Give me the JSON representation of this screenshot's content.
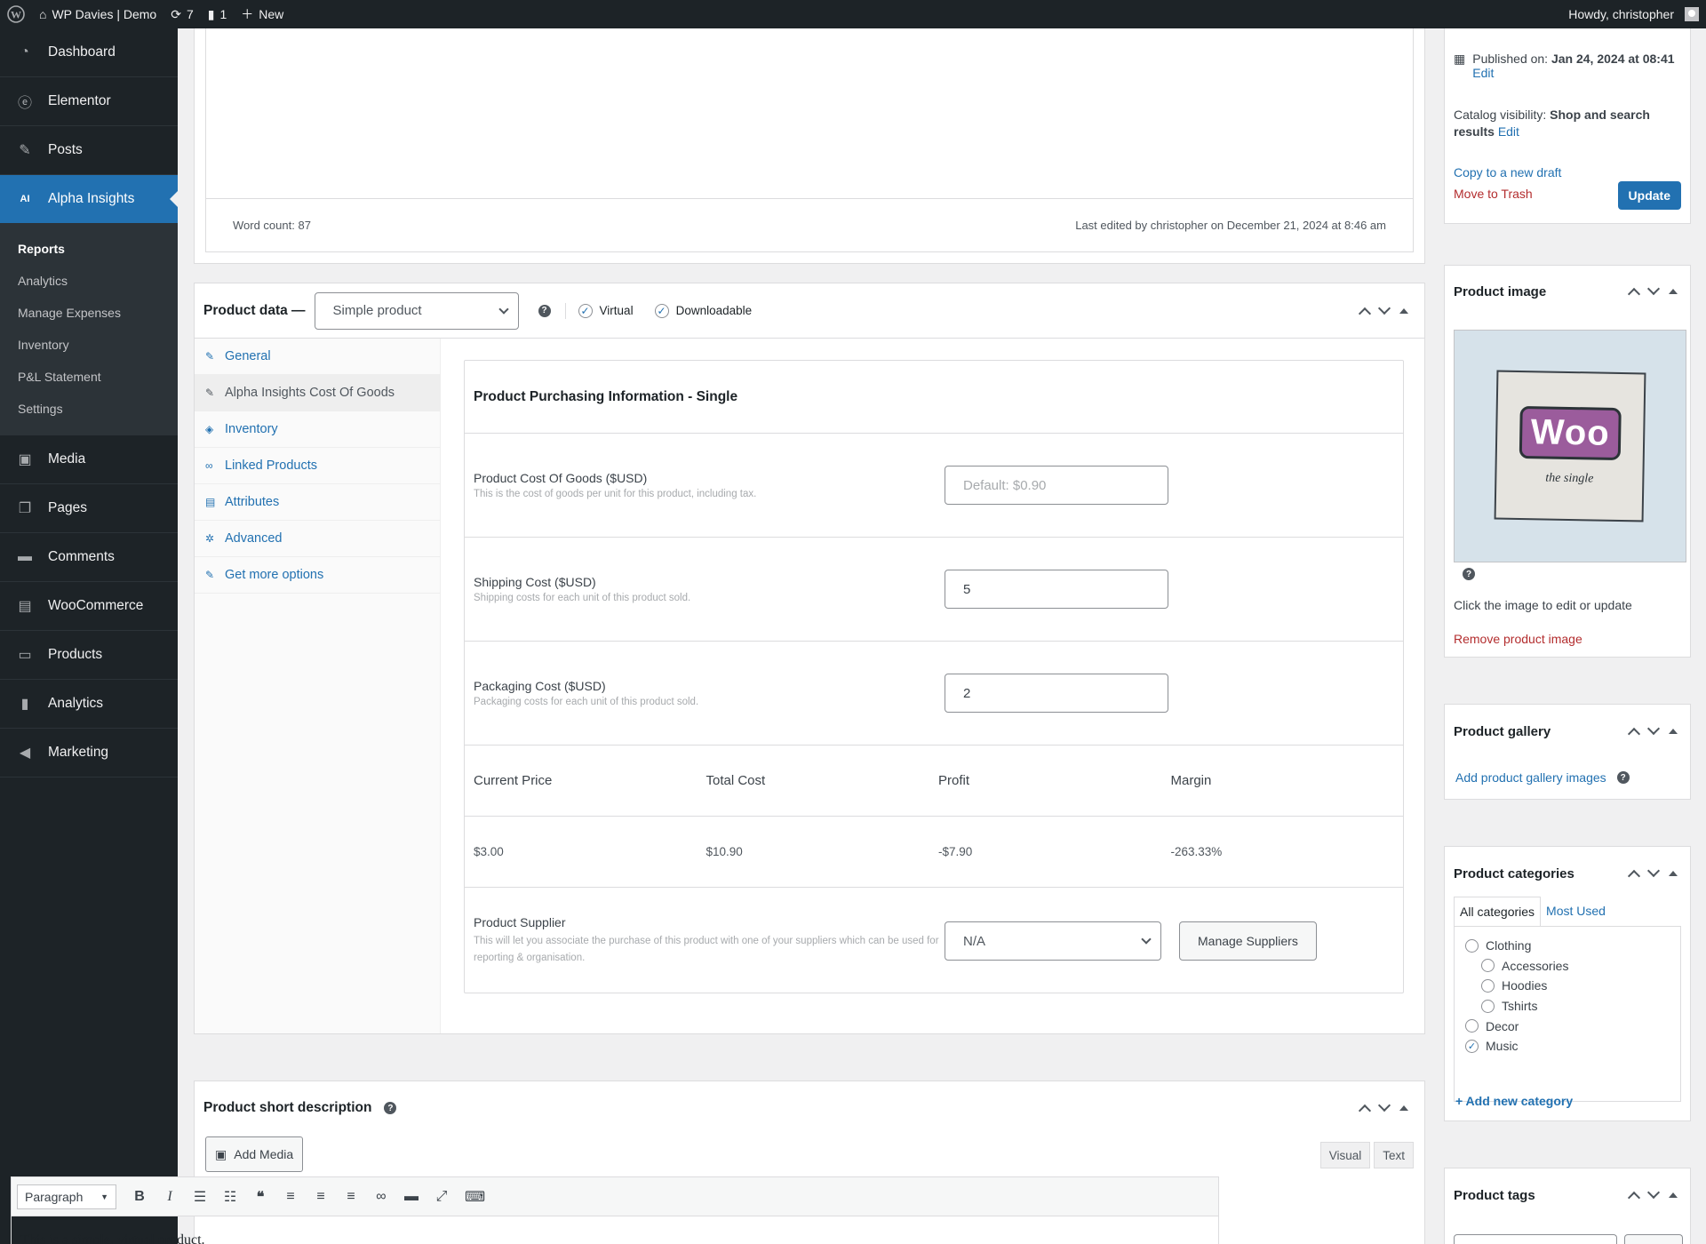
{
  "adminbar": {
    "site_name": "WP Davies | Demo",
    "updates_count": "7",
    "comments_count": "1",
    "new_label": "New",
    "howdy": "Howdy, christopher"
  },
  "sidebar": {
    "items": [
      {
        "label": "Dashboard",
        "icon": "dashboard-icon"
      },
      {
        "label": "Elementor",
        "icon": "elementor-icon"
      },
      {
        "label": "Posts",
        "icon": "pin-icon"
      },
      {
        "label": "Alpha Insights",
        "icon": "ai-icon"
      },
      {
        "label": "Media",
        "icon": "media-icon"
      },
      {
        "label": "Pages",
        "icon": "pages-icon"
      },
      {
        "label": "Comments",
        "icon": "comment-icon"
      },
      {
        "label": "WooCommerce",
        "icon": "woo-icon"
      },
      {
        "label": "Products",
        "icon": "archive-icon"
      },
      {
        "label": "Analytics",
        "icon": "chart-icon"
      },
      {
        "label": "Marketing",
        "icon": "megaphone-icon"
      }
    ],
    "ai_badge": "AI",
    "submenu": [
      "Reports",
      "Analytics",
      "Manage Expenses",
      "Inventory",
      "P&L Statement",
      "Settings"
    ]
  },
  "editor": {
    "word_count": "Word count: 87",
    "last_edited": "Last edited by christopher on December 21, 2024 at 8:46 am"
  },
  "product_data": {
    "title": "Product data —",
    "type_value": "Simple product",
    "virtual_label": "Virtual",
    "downloadable_label": "Downloadable",
    "tabs": [
      "General",
      "Alpha Insights Cost Of Goods",
      "Inventory",
      "Linked Products",
      "Attributes",
      "Advanced",
      "Get more options"
    ],
    "cog": {
      "title": "Product Purchasing Information - Single",
      "rows": [
        {
          "label": "Product Cost Of Goods ($USD)",
          "desc": "This is the cost of goods per unit for this product, including tax.",
          "value": "",
          "placeholder": "Default: $0.90"
        },
        {
          "label": "Shipping Cost ($USD)",
          "desc": "Shipping costs for each unit of this product sold.",
          "value": "5",
          "placeholder": ""
        },
        {
          "label": "Packaging Cost ($USD)",
          "desc": "Packaging costs for each unit of this product sold.",
          "value": "2",
          "placeholder": ""
        }
      ],
      "summary_headers": [
        "Current Price",
        "Total Cost",
        "Profit",
        "Margin"
      ],
      "summary_values": [
        "$3.00",
        "$10.90",
        "-$7.90",
        "-263.33%"
      ],
      "supplier_label": "Product Supplier",
      "supplier_desc": "This will let you associate the purchase of this product with one of your suppliers which can be used for reporting & organisation.",
      "supplier_value": "N/A",
      "manage_suppliers": "Manage Suppliers"
    }
  },
  "short_description": {
    "title": "Product short description",
    "add_media": "Add Media",
    "visual": "Visual",
    "text": "Text",
    "format": "Paragraph",
    "content": "This is a simple, virtual product."
  },
  "publish": {
    "published_prefix": "Published on:",
    "published_date": "Jan 24, 2024 at 08:41",
    "edit": "Edit",
    "catalog_prefix": "Catalog visibility:",
    "catalog_value": "Shop and search results",
    "copy_draft": "Copy to a new draft",
    "trash": "Move to Trash",
    "update": "Update"
  },
  "product_image": {
    "title": "Product image",
    "image_word": "Woo",
    "image_sub": "the single",
    "click_hint": "Click the image to edit or update",
    "remove": "Remove product image"
  },
  "product_gallery": {
    "title": "Product gallery",
    "add_link": "Add product gallery images"
  },
  "product_categories": {
    "title": "Product categories",
    "tab_all": "All categories",
    "tab_most": "Most Used",
    "items": [
      {
        "label": "Clothing",
        "level": 0,
        "checked": false
      },
      {
        "label": "Accessories",
        "level": 1,
        "checked": false
      },
      {
        "label": "Hoodies",
        "level": 1,
        "checked": false
      },
      {
        "label": "Tshirts",
        "level": 1,
        "checked": false
      },
      {
        "label": "Decor",
        "level": 0,
        "checked": false
      },
      {
        "label": "Music",
        "level": 0,
        "checked": true
      }
    ],
    "add_new": "+ Add new category"
  },
  "product_tags": {
    "title": "Product tags"
  },
  "colors": {
    "admin_dark": "#1d2327",
    "accent": "#2271b1",
    "trash_red": "#b32d2e"
  }
}
